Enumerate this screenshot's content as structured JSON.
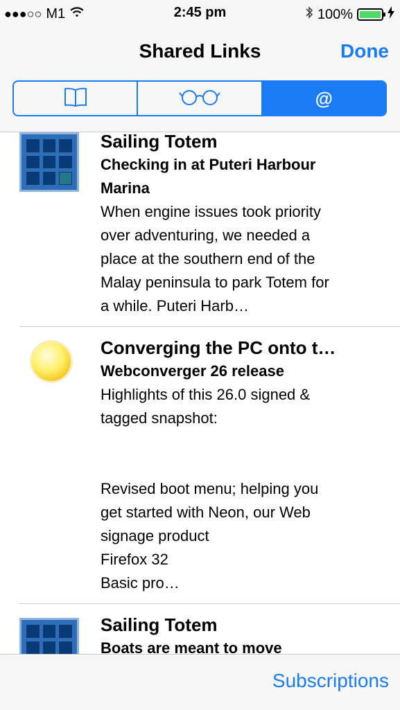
{
  "status": {
    "signal_dots": "●●●○○",
    "carrier": "M1",
    "time": "2:45 pm",
    "battery_percent": "100%",
    "battery_level": 1.0
  },
  "nav": {
    "title": "Shared Links",
    "done_label": "Done"
  },
  "segments": [
    {
      "icon": "book-icon"
    },
    {
      "icon": "glasses-icon"
    },
    {
      "icon": "at-icon",
      "glyph": "@"
    }
  ],
  "feed": [
    {
      "icon": "grid-thumbnail-icon",
      "site": "Sailing Totem",
      "headline_1": "Checking in at Puteri Harbour",
      "headline_2": "Marina",
      "body": "When engine issues took priority\nover adventuring, we needed a\nplace at the southern end of the\nMalay peninsula to park Totem for\na while. Puteri Harb…"
    },
    {
      "icon": "sun-icon",
      "site": "Converging the PC onto t…",
      "headline_1": "Webconverger 26 release",
      "body": "Highlights of this 26.0 signed &\ntagged snapshot:\n\n\nRevised boot menu; helping you\nget started with Neon, our Web\nsignage product\nFirefox 32\nBasic pro…"
    },
    {
      "icon": "grid-thumbnail-icon",
      "site": "Sailing Totem",
      "headline_1": "Boats are meant to move"
    }
  ],
  "toolbar": {
    "subscriptions_label": "Subscriptions"
  },
  "colors": {
    "accent": "#1a7cf5",
    "bar_bg": "#f7f7f7",
    "battery": "#4cd964",
    "separator": "#c8c7cc"
  }
}
